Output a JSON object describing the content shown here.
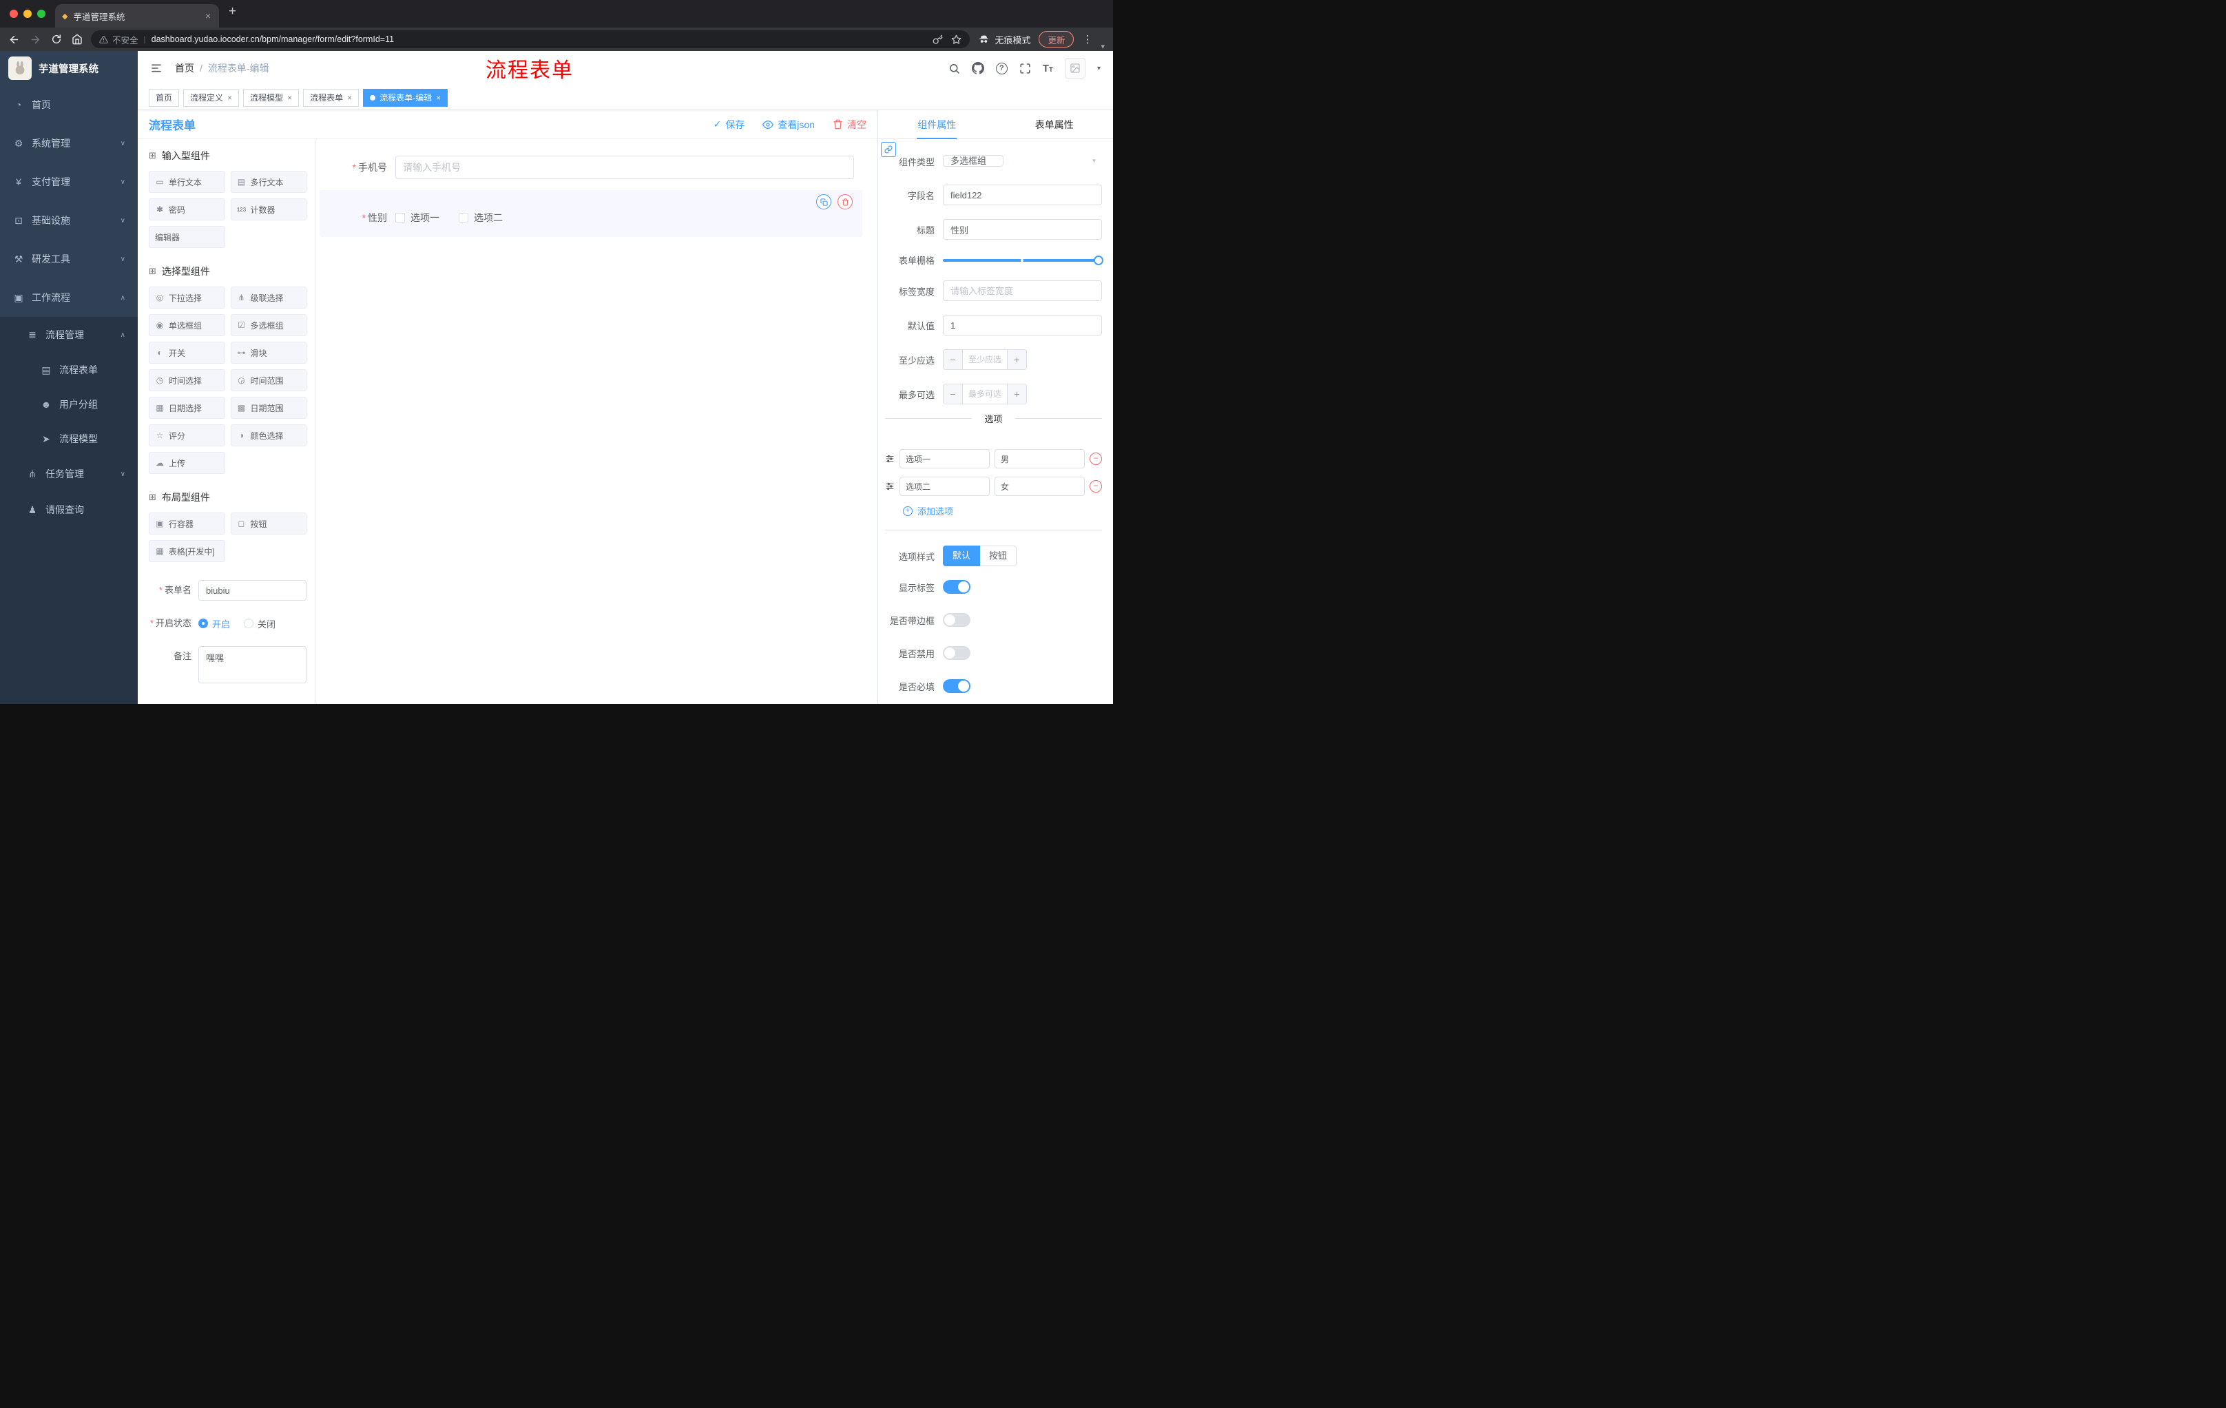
{
  "colors": {
    "primary": "#409eff",
    "danger": "#f56c6c",
    "sidebar_bg": "#304156",
    "annotation_red": "#fe0000",
    "active_item_bg": "#f6f7ff"
  },
  "browser": {
    "tab_title": "芋道管理系统",
    "security_label": "不安全",
    "url": "dashboard.yudao.iocoder.cn/bpm/manager/form/edit?formId=11",
    "incognito_label": "无痕模式",
    "update_label": "更新"
  },
  "sidebar": {
    "title": "芋道管理系统",
    "items": [
      {
        "label": "首页"
      },
      {
        "label": "系统管理"
      },
      {
        "label": "支付管理"
      },
      {
        "label": "基础设施"
      },
      {
        "label": "研发工具"
      },
      {
        "label": "工作流程"
      },
      {
        "label": "流程管理"
      },
      {
        "label": "流程表单"
      },
      {
        "label": "用户分组"
      },
      {
        "label": "流程模型"
      },
      {
        "label": "任务管理"
      },
      {
        "label": "请假查询"
      }
    ]
  },
  "header": {
    "breadcrumb_home": "首页",
    "breadcrumb_sep": "/",
    "breadcrumb_current": "流程表单-编辑",
    "annotation": "流程表单"
  },
  "tags": [
    {
      "label": "首页"
    },
    {
      "label": "流程定义"
    },
    {
      "label": "流程模型"
    },
    {
      "label": "流程表单"
    },
    {
      "label": "流程表单-编辑"
    }
  ],
  "designer": {
    "title": "流程表单",
    "save_label": "保存",
    "view_json_label": "查看json",
    "clear_label": "清空"
  },
  "palette": {
    "groups": [
      {
        "title": "输入型组件",
        "items": [
          {
            "label": "单行文本"
          },
          {
            "label": "多行文本"
          },
          {
            "label": "密码"
          },
          {
            "label": "计数器"
          },
          {
            "label": "编辑器"
          }
        ]
      },
      {
        "title": "选择型组件",
        "items": [
          {
            "label": "下拉选择"
          },
          {
            "label": "级联选择"
          },
          {
            "label": "单选框组"
          },
          {
            "label": "多选框组"
          },
          {
            "label": "开关"
          },
          {
            "label": "滑块"
          },
          {
            "label": "时间选择"
          },
          {
            "label": "时间范围"
          },
          {
            "label": "日期选择"
          },
          {
            "label": "日期范围"
          },
          {
            "label": "评分"
          },
          {
            "label": "颜色选择"
          },
          {
            "label": "上传"
          }
        ]
      },
      {
        "title": "布局型组件",
        "items": [
          {
            "label": "行容器"
          },
          {
            "label": "按钮"
          },
          {
            "label": "表格[开发中]"
          }
        ]
      }
    ],
    "form": {
      "name_label": "表单名",
      "name_value": "biubiu",
      "status_label": "开启状态",
      "status_on": "开启",
      "status_off": "关闭",
      "remark_label": "备注",
      "remark_value": "嘿嘿"
    }
  },
  "canvas": {
    "phone_label": "手机号",
    "phone_placeholder": "请输入手机号",
    "gender_label": "性别",
    "gender_options": [
      {
        "label": "选项一"
      },
      {
        "label": "选项二"
      }
    ]
  },
  "props": {
    "tab_component": "组件属性",
    "tab_form": "表单属性",
    "component_type_label": "组件类型",
    "component_type_value": "多选框组",
    "field_name_label": "字段名",
    "field_name_value": "field122",
    "title_label": "标题",
    "title_value": "性别",
    "grid_label": "表单栅格",
    "label_width_label": "标签宽度",
    "label_width_placeholder": "请输入标签宽度",
    "default_label": "默认值",
    "default_value": "1",
    "min_label": "至少应选",
    "min_placeholder": "至少应选",
    "max_label": "最多可选",
    "max_placeholder": "最多可选",
    "options_title": "选项",
    "options": [
      {
        "name": "选项一",
        "value": "男"
      },
      {
        "name": "选项二",
        "value": "女"
      }
    ],
    "add_option_label": "添加选项",
    "option_style_label": "选项样式",
    "style_default": "默认",
    "style_button": "按钮",
    "show_label_label": "显示标签",
    "border_label": "是否带边框",
    "disabled_label": "是否禁用",
    "required_label": "是否必填"
  },
  "ui": {
    "required_mark": "*"
  }
}
